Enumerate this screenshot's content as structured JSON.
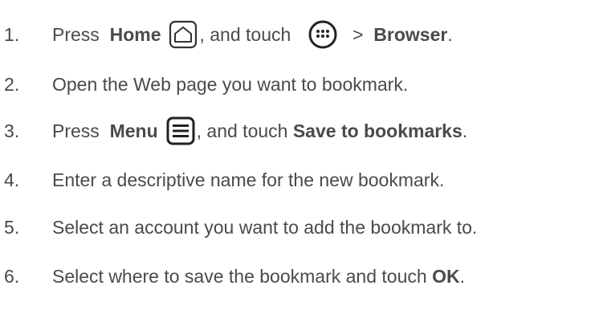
{
  "steps": [
    {
      "number": "1.",
      "parts": {
        "a": "Press ",
        "b": "Home",
        "c": ", and touch ",
        "d": " > ",
        "e": "Browser",
        "f": "."
      },
      "icons": [
        "home-icon",
        "apps-icon"
      ]
    },
    {
      "number": "2.",
      "text": "Open the Web page you want to bookmark."
    },
    {
      "number": "3.",
      "parts": {
        "a": "Press ",
        "b": "Menu",
        "c": ", and touch ",
        "d": "Save to bookmarks",
        "e": "."
      },
      "icons": [
        "menu-icon"
      ]
    },
    {
      "number": "4.",
      "text": "Enter a descriptive name for the new bookmark."
    },
    {
      "number": "5.",
      "text": "Select an account you want to add the bookmark to."
    },
    {
      "number": "6.",
      "parts": {
        "a": "Select where to save the bookmark and touch ",
        "b": "OK",
        "c": "."
      }
    }
  ],
  "colors": {
    "text": "#4a4a4a",
    "icon_stroke": "#333333"
  }
}
